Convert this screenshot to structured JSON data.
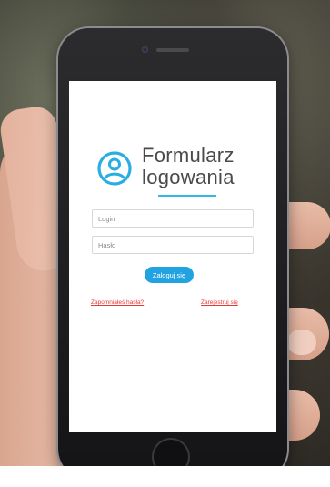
{
  "login_form": {
    "title_line1": "Formularz",
    "title_line2": "logowania",
    "login_placeholder": "Login",
    "password_placeholder": "Hasło",
    "submit_label": "Zaloguj się",
    "forgot_password_label": "Zapomniałeś hasła?",
    "register_label": "Zarejestruj się"
  },
  "icons": {
    "user": "user-circle-icon"
  },
  "colors": {
    "accent": "#35b8e4",
    "button": "#21a3e1",
    "link": "#e53935",
    "title": "#4a4a4a"
  }
}
